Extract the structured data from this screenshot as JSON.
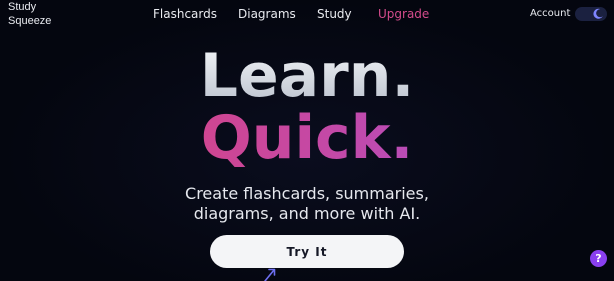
{
  "brand": {
    "line1": "Study",
    "line2": "Squeeze"
  },
  "nav": {
    "items": [
      {
        "label": "Flashcards"
      },
      {
        "label": "Diagrams"
      },
      {
        "label": "Study"
      },
      {
        "label": "Upgrade"
      }
    ],
    "account_label": "Account"
  },
  "theme_toggle": {
    "icon": "moon-icon",
    "state": "dark"
  },
  "hero": {
    "line1": "Learn.",
    "line2": "Quick.",
    "subtitle_line1": "Create flashcards, summaries,",
    "subtitle_line2": "diagrams, and more with AI."
  },
  "cta": {
    "label": "Try It"
  },
  "help": {
    "label": "?"
  },
  "colors": {
    "background": "#050714",
    "accent_pink": "#d44b8c",
    "gradient_start": "#e2406f",
    "gradient_end": "#9e56e0",
    "help_purple": "#8a3ff0"
  }
}
